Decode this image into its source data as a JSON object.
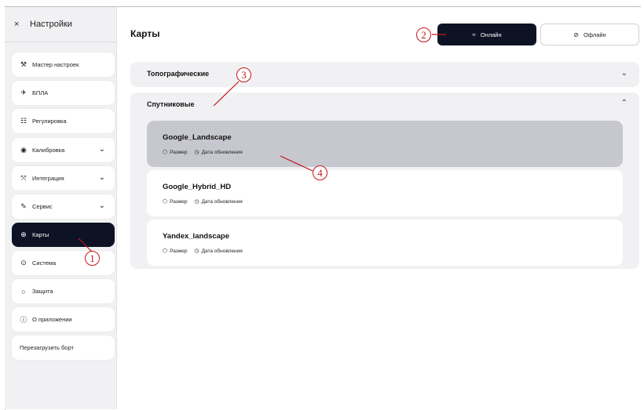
{
  "sidebar": {
    "close_glyph": "×",
    "title": "Настройки",
    "items": [
      {
        "label": "Мастер настроек",
        "icon": "wand-icon"
      },
      {
        "label": "БПЛА",
        "icon": "drone-icon"
      },
      {
        "label": "Регулировка",
        "icon": "sliders-icon"
      },
      {
        "label": "Калибровка",
        "icon": "calibration-icon",
        "expandable": true
      },
      {
        "label": "Интеграция",
        "icon": "integration-icon",
        "expandable": true
      },
      {
        "label": "Сервис",
        "icon": "wrench-icon",
        "expandable": true
      },
      {
        "label": "Карты",
        "icon": "globe-icon",
        "active": true
      },
      {
        "label": "Система",
        "icon": "system-icon"
      },
      {
        "label": "Защита",
        "icon": "shield-icon"
      },
      {
        "label": "О приложении",
        "icon": "info-icon"
      }
    ],
    "reboot_label": "Перезагрузить борт"
  },
  "header": {
    "title": "Карты",
    "online_label": "Онлайн",
    "offline_label": "Офлайн"
  },
  "categories": {
    "topo_label": "Топографические",
    "sat_label": "Спутниковые"
  },
  "maps": [
    {
      "name": "Google_Landscape",
      "size_label": "Размер",
      "date_label": "Дата обновления",
      "selected": true
    },
    {
      "name": "Google_Hybrid_HD",
      "size_label": "Размер",
      "date_label": "Дата обновления"
    },
    {
      "name": "Yandex_landscape",
      "size_label": "Размер",
      "date_label": "Дата обновления"
    }
  ],
  "callouts": [
    "1",
    "2",
    "3",
    "4"
  ],
  "colors": {
    "accent_dark": "#0d1324",
    "selected_card": "#c6c7cf",
    "panel_bg": "#f1f1f4",
    "annotation_red": "#c4141c"
  }
}
